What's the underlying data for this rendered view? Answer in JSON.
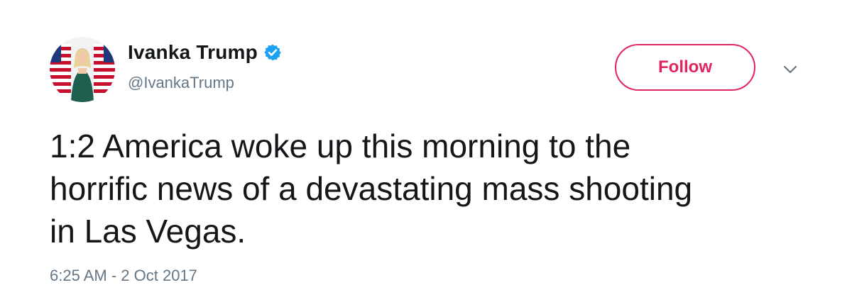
{
  "colors": {
    "accent": "#e0245e",
    "verified": "#1da1f2",
    "secondary_text": "#657786",
    "primary_text": "#14171a"
  },
  "author": {
    "display_name": "Ivanka Trump",
    "handle": "@IvankaTrump",
    "verified_icon": "verified-badge-icon",
    "avatar": "profile-photo"
  },
  "actions": {
    "follow_label": "Follow",
    "menu_icon": "chevron-down-icon"
  },
  "tweet": {
    "text": "1:2 America woke up this morning to the\nhorrific news of a devastating mass shooting\nin Las Vegas.",
    "timestamp": "6:25 AM - 2 Oct 2017"
  }
}
